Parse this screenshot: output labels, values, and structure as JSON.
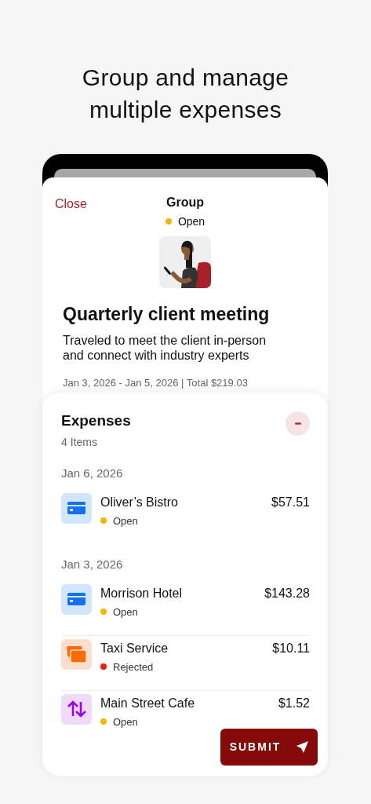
{
  "headline": "Group and manage multiple expenses",
  "sheet": {
    "close": "Close",
    "title": "Group",
    "status": {
      "label": "Open",
      "color": "#f7b500"
    }
  },
  "group": {
    "name": "Quarterly client meeting",
    "description": "Traveled to meet the client in-person and connect with industry experts",
    "summary": "Jan 3, 2026 - Jan 5, 2026 | Total $219.03"
  },
  "expenses": {
    "title": "Expenses",
    "count": "4 Items",
    "menu": "•••",
    "sections": [
      {
        "date": "Jan 6, 2026",
        "items": [
          {
            "kind": "card",
            "name": "Oliver’s Bistro",
            "amount": "$57.51",
            "status": "Open",
            "color": "#f7b500"
          }
        ]
      },
      {
        "date": "Jan 3, 2026",
        "items": [
          {
            "kind": "card",
            "name": "Morrison Hotel",
            "amount": "$143.28",
            "status": "Open",
            "color": "#f7b500"
          },
          {
            "kind": "cards",
            "name": "Taxi Service",
            "amount": "$10.11",
            "status": "Rejected",
            "color": "#f21d0d"
          },
          {
            "kind": "transfer",
            "name": "Main Street Cafe",
            "amount": "$1.52",
            "status": "Open",
            "color": "#f7b500"
          }
        ]
      }
    ]
  },
  "submit": "SUBMIT"
}
